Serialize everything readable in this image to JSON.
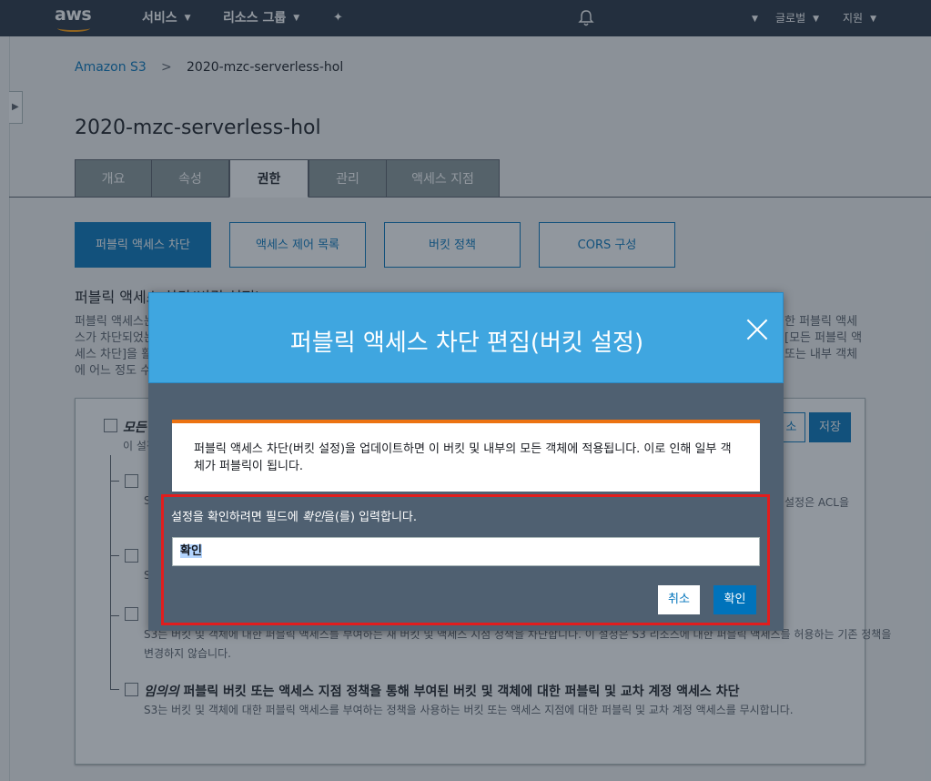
{
  "topnav": {
    "logo": "aws",
    "services": "서비스",
    "resource_groups": "리소스 그룹",
    "region": "글로벌",
    "support": "지원"
  },
  "breadcrumb": {
    "root": "Amazon S3",
    "separator": ">",
    "current": "2020-mzc-serverless-hol"
  },
  "page_title": "2020-mzc-serverless-hol",
  "tabs": [
    "개요",
    "속성",
    "권한",
    "관리",
    "액세스 지점"
  ],
  "subtabs": [
    "퍼블릭 액세스 차단",
    "액세스 제어 목록",
    "버킷 정책",
    "CORS 구성"
  ],
  "section": {
    "title": "퍼블릭 액세스 차단(버킷 설정)",
    "desc_left": [
      "퍼블릭 액세스는",
      "스가 차단되었는",
      "세스 차단]을 활",
      "에 어느 정도 수"
    ],
    "desc_right": [
      "한 퍼블릭 액세",
      "[모든 퍼블릭 액",
      "또는 내부 객체"
    ]
  },
  "panel": {
    "cancel_label": "소",
    "save_label": "저장",
    "all_label": "모든",
    "all_sub": "이 설정",
    "items": [
      {
        "title_head": "",
        "sub_head": "S",
        "sub_right": "설정은 ACL을"
      },
      {
        "title_head": "",
        "sub_head": "S"
      },
      {
        "title_head": "",
        "sub_line1": "S3는 버킷 및 객체에 대한 퍼블릭 액세스를 부여하는 새 버킷 및 액세스 지점 정책을 차단합니다. 이 설정은 S3 리소스에 대한 퍼블릭 액세스를 허용하는 기존 정책을",
        "sub_line2": "변경하지 않습니다."
      },
      {
        "title_em": "임의의",
        "title_rest": " 퍼블릭 버킷 또는 액세스 지점 정책을 통해 부여된 버킷 및 객체에 대한 퍼블릭 및 교차 계정 액세스 차단",
        "sub": "S3는 버킷 및 객체에 대한 퍼블릭 액세스를 부여하는 정책을 사용하는 버킷 또는 액세스 지점에 대한 퍼블릭 및 교차 계정 액세스를 무시합니다."
      }
    ]
  },
  "modal": {
    "title": "퍼블릭 액세스 차단 편집(버킷 설정)",
    "warning_line1": "퍼블릭 액세스 차단(버킷 설정)을 업데이트하면 이 버킷 및 내부의 모든 객체에 적용됩니다. 이로 인해 일부 객",
    "warning_line2": "체가 퍼블릭이 됩니다.",
    "confirm_pre": "설정을 확인하려면 필드에 ",
    "confirm_em": "확인",
    "confirm_post": "을(를) 입력합니다.",
    "input_value": "확인",
    "cancel": "취소",
    "confirm": "확인"
  },
  "colors": {
    "nav": "#232f3e",
    "accent": "#0073bb",
    "modal_head": "#3fa6e0",
    "warning": "#ec7211",
    "highlight": "#e11d1d"
  }
}
